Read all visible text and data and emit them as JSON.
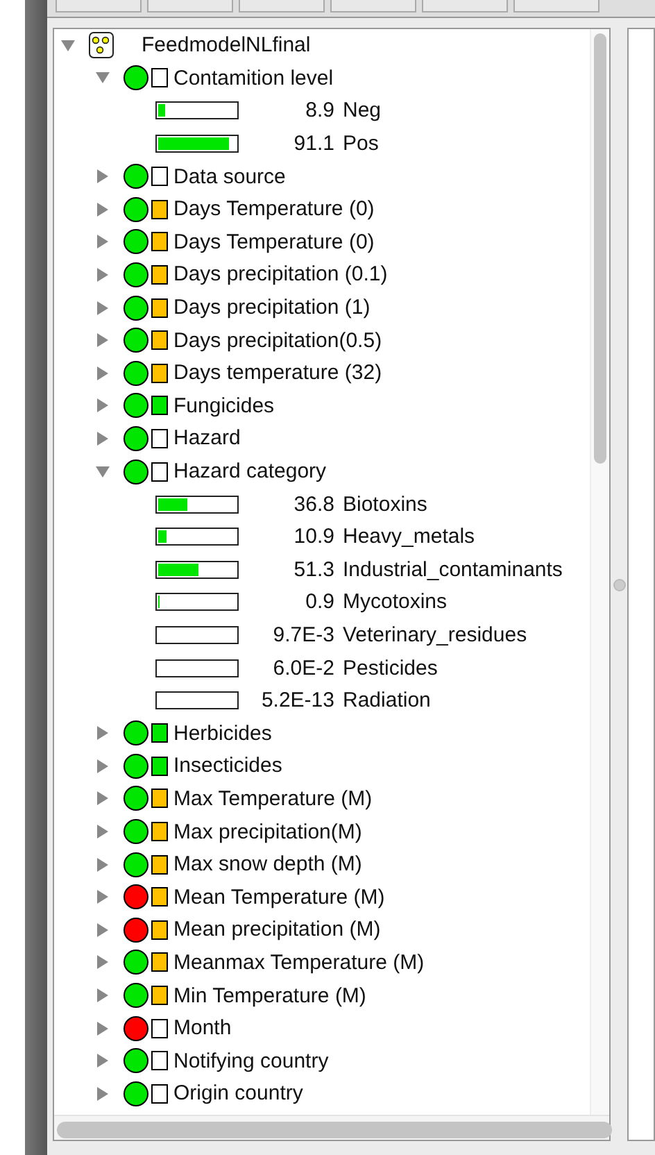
{
  "toolbar": {
    "buttons": [
      {
        "kind": "button"
      },
      {
        "kind": "button"
      },
      {
        "kind": "button"
      },
      {
        "kind": "button"
      },
      {
        "kind": "button"
      },
      {
        "kind": "button"
      }
    ]
  },
  "tree": {
    "root": {
      "label": "FeedmodelNLfinal",
      "expanded": true
    },
    "nodes": [
      {
        "label": "Contamition level",
        "color": "#00e600",
        "square": {
          "color": "#ffffff"
        },
        "expanded": true,
        "states": [
          {
            "probability": "8.9",
            "name": "Neg",
            "level": 0.089
          },
          {
            "probability": "91.1",
            "name": "Pos",
            "level": 0.911
          }
        ]
      },
      {
        "label": "Data source",
        "color": "#00e600",
        "square": {
          "color": "#ffffff"
        },
        "expanded": false
      },
      {
        "label": "Days Temperature (0)",
        "color": "#00e600",
        "square": {
          "color": "#ffc000"
        },
        "expanded": false
      },
      {
        "label": "Days Temperature (0)",
        "color": "#00e600",
        "square": {
          "color": "#ffc000"
        },
        "expanded": false
      },
      {
        "label": "Days precipitation (0.1)",
        "color": "#00e600",
        "square": {
          "color": "#ffc000"
        },
        "expanded": false
      },
      {
        "label": "Days precipitation (1)",
        "color": "#00e600",
        "square": {
          "color": "#ffc000"
        },
        "expanded": false
      },
      {
        "label": "Days precipitation(0.5)",
        "color": "#00e600",
        "square": {
          "color": "#ffc000"
        },
        "expanded": false
      },
      {
        "label": "Days temperature (32)",
        "color": "#00e600",
        "square": {
          "color": "#ffc000"
        },
        "expanded": false
      },
      {
        "label": "Fungicides",
        "color": "#00e600",
        "square": {
          "color": "#00e600"
        },
        "expanded": false
      },
      {
        "label": "Hazard",
        "color": "#00e600",
        "square": {
          "color": "#ffffff"
        },
        "expanded": false
      },
      {
        "label": "Hazard category",
        "color": "#00e600",
        "square": {
          "color": "#ffffff"
        },
        "expanded": true,
        "states": [
          {
            "probability": "36.8",
            "name": "Biotoxins",
            "level": 0.368
          },
          {
            "probability": "10.9",
            "name": "Heavy_metals",
            "level": 0.109
          },
          {
            "probability": "51.3",
            "name": "Industrial_contaminants",
            "level": 0.513
          },
          {
            "probability": "0.9",
            "name": "Mycotoxins",
            "level": 0.009
          },
          {
            "probability": "9.7E-3",
            "name": "Veterinary_residues",
            "level": 0
          },
          {
            "probability": "6.0E-2",
            "name": "Pesticides",
            "level": 0
          },
          {
            "probability": "5.2E-13",
            "name": "Radiation",
            "level": 0
          }
        ]
      },
      {
        "label": "Herbicides",
        "color": "#00e600",
        "square": {
          "color": "#00e600"
        },
        "expanded": false
      },
      {
        "label": "Insecticides",
        "color": "#00e600",
        "square": {
          "color": "#00e600"
        },
        "expanded": false
      },
      {
        "label": "Max Temperature (M)",
        "color": "#00e600",
        "square": {
          "color": "#ffc000"
        },
        "expanded": false
      },
      {
        "label": "Max precipitation(M)",
        "color": "#00e600",
        "square": {
          "color": "#ffc000"
        },
        "expanded": false
      },
      {
        "label": "Max snow depth (M)",
        "color": "#00e600",
        "square": {
          "color": "#ffc000"
        },
        "expanded": false
      },
      {
        "label": "Mean Temperature (M)",
        "color": "#ff0000",
        "square": {
          "color": "#ffc000"
        },
        "expanded": false
      },
      {
        "label": "Mean precipitation (M)",
        "color": "#ff0000",
        "square": {
          "color": "#ffc000"
        },
        "expanded": false
      },
      {
        "label": "Meanmax Temperature (M)",
        "color": "#00e600",
        "square": {
          "color": "#ffc000"
        },
        "expanded": false
      },
      {
        "label": "Min Temperature (M)",
        "color": "#00e600",
        "square": {
          "color": "#ffc000"
        },
        "expanded": false
      },
      {
        "label": "Month",
        "color": "#ff0000",
        "square": {
          "color": "#ffffff"
        },
        "expanded": false
      },
      {
        "label": "Notifying country",
        "color": "#00e600",
        "square": {
          "color": "#ffffff"
        },
        "expanded": false
      },
      {
        "label": "Origin country",
        "color": "#00e600",
        "square": {
          "color": "#ffffff"
        },
        "expanded": false
      }
    ]
  }
}
